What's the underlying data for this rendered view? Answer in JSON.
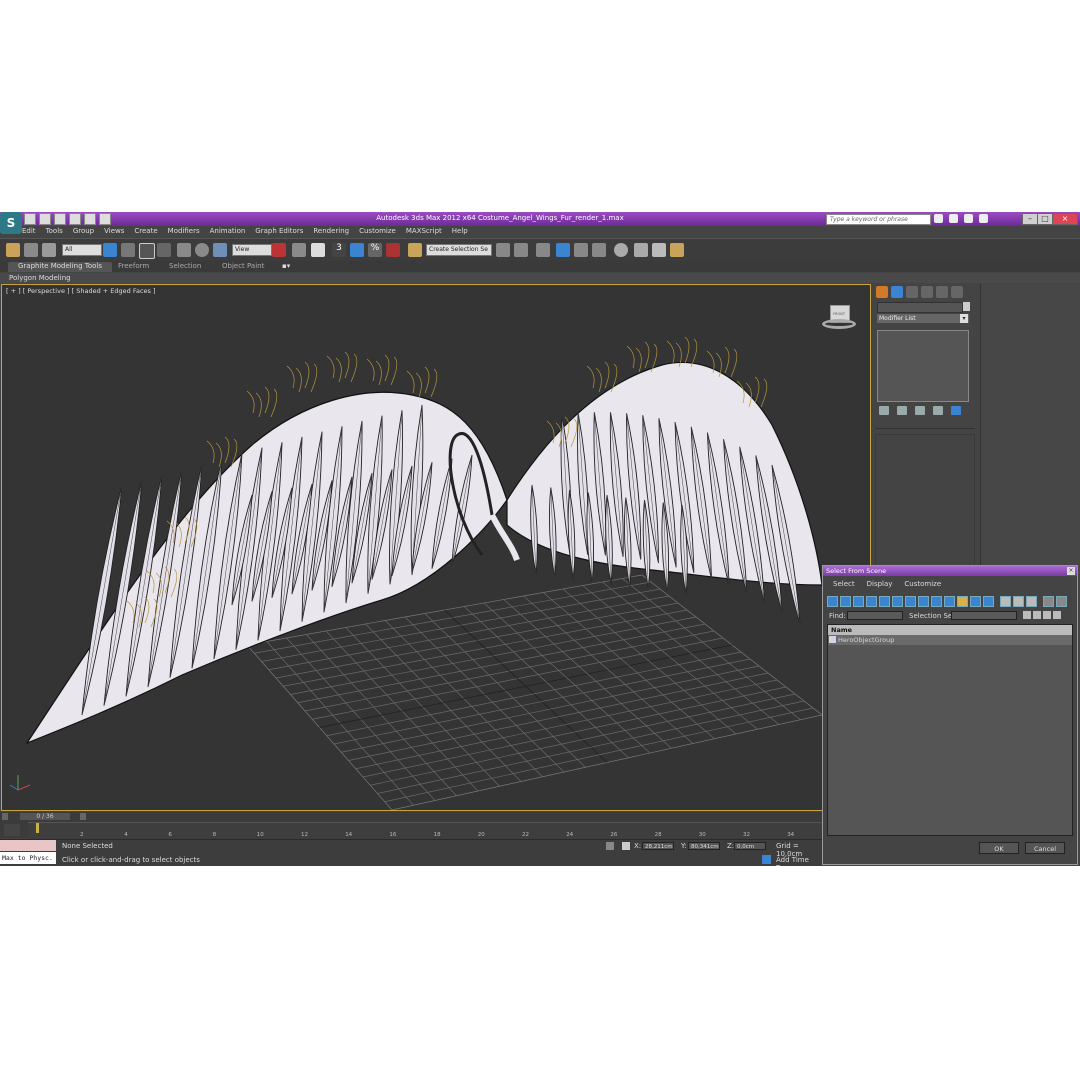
{
  "titlebar": {
    "title": "Autodesk 3ds Max  2012 x64     Costume_Angel_Wings_Fur_render_1.max",
    "search_placeholder": "Type a keyword or phrase"
  },
  "menu": [
    "Edit",
    "Tools",
    "Group",
    "Views",
    "Create",
    "Modifiers",
    "Animation",
    "Graph Editors",
    "Rendering",
    "Customize",
    "MAXScript",
    "Help"
  ],
  "toolbar": {
    "filter_value": "All",
    "refcoord_value": "View",
    "selection_set_value": "Create Selection Se",
    "snap_label": "3"
  },
  "ribbon": {
    "tabs": [
      "Graphite Modeling Tools",
      "Freeform",
      "Selection",
      "Object Paint"
    ],
    "sub_label": "Polygon Modeling"
  },
  "viewport": {
    "label": "[ + ] [ Perspective ] [ Shaded + Edged Faces ]",
    "viewcube_label": "FRONT"
  },
  "command_panel": {
    "modifier_list": "Modifier List"
  },
  "timeline": {
    "slider": "0 / 36",
    "ticks": [
      "2",
      "4",
      "6",
      "8",
      "10",
      "12",
      "14",
      "16",
      "18",
      "20",
      "22",
      "24",
      "26",
      "28",
      "30",
      "32",
      "34"
    ]
  },
  "status": {
    "max_to_physc": "Max to Physc.",
    "selection": "None Selected",
    "prompt": "Click or click-and-drag to select objects",
    "x_label": "X:",
    "x_value": "28,211cm",
    "y_label": "Y:",
    "y_value": "80,341cm",
    "z_label": "Z:",
    "z_value": "0,0cm",
    "grid": "Grid = 10,0cm",
    "add_time_tag": "Add Time Tag"
  },
  "dialog": {
    "title": "Select From Scene",
    "menu": [
      "Select",
      "Display",
      "Customize"
    ],
    "find_label": "Find:",
    "selection_set_label": "Selection Set:",
    "header_name": "Name",
    "rows": [
      "HeroObjectGroup"
    ],
    "ok": "OK",
    "cancel": "Cancel"
  },
  "colors": {
    "titlebar": "#8a3fb8",
    "viewport_border": "#c8a43c",
    "viewport_bg": "#343434",
    "fur": "#b8963c",
    "wing_fill": "#e9e6ee"
  }
}
